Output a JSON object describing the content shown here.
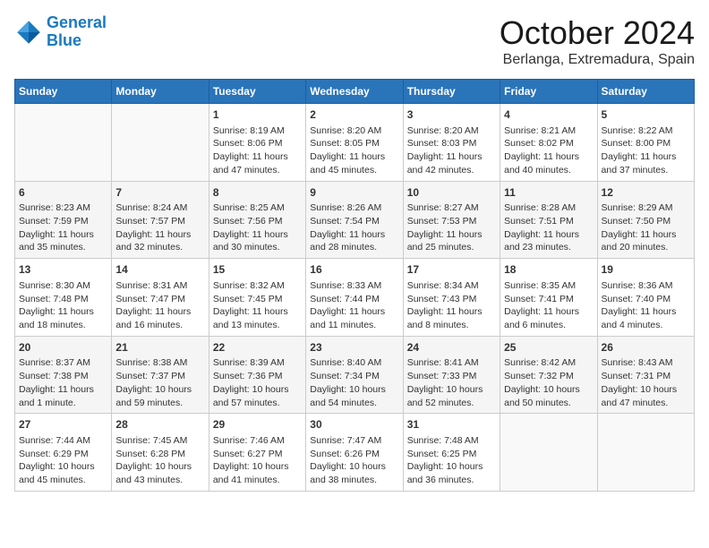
{
  "header": {
    "logo_line1": "General",
    "logo_line2": "Blue",
    "month": "October 2024",
    "location": "Berlanga, Extremadura, Spain"
  },
  "days_of_week": [
    "Sunday",
    "Monday",
    "Tuesday",
    "Wednesday",
    "Thursday",
    "Friday",
    "Saturday"
  ],
  "weeks": [
    [
      {
        "day": "",
        "info": ""
      },
      {
        "day": "",
        "info": ""
      },
      {
        "day": "1",
        "info": "Sunrise: 8:19 AM\nSunset: 8:06 PM\nDaylight: 11 hours and 47 minutes."
      },
      {
        "day": "2",
        "info": "Sunrise: 8:20 AM\nSunset: 8:05 PM\nDaylight: 11 hours and 45 minutes."
      },
      {
        "day": "3",
        "info": "Sunrise: 8:20 AM\nSunset: 8:03 PM\nDaylight: 11 hours and 42 minutes."
      },
      {
        "day": "4",
        "info": "Sunrise: 8:21 AM\nSunset: 8:02 PM\nDaylight: 11 hours and 40 minutes."
      },
      {
        "day": "5",
        "info": "Sunrise: 8:22 AM\nSunset: 8:00 PM\nDaylight: 11 hours and 37 minutes."
      }
    ],
    [
      {
        "day": "6",
        "info": "Sunrise: 8:23 AM\nSunset: 7:59 PM\nDaylight: 11 hours and 35 minutes."
      },
      {
        "day": "7",
        "info": "Sunrise: 8:24 AM\nSunset: 7:57 PM\nDaylight: 11 hours and 32 minutes."
      },
      {
        "day": "8",
        "info": "Sunrise: 8:25 AM\nSunset: 7:56 PM\nDaylight: 11 hours and 30 minutes."
      },
      {
        "day": "9",
        "info": "Sunrise: 8:26 AM\nSunset: 7:54 PM\nDaylight: 11 hours and 28 minutes."
      },
      {
        "day": "10",
        "info": "Sunrise: 8:27 AM\nSunset: 7:53 PM\nDaylight: 11 hours and 25 minutes."
      },
      {
        "day": "11",
        "info": "Sunrise: 8:28 AM\nSunset: 7:51 PM\nDaylight: 11 hours and 23 minutes."
      },
      {
        "day": "12",
        "info": "Sunrise: 8:29 AM\nSunset: 7:50 PM\nDaylight: 11 hours and 20 minutes."
      }
    ],
    [
      {
        "day": "13",
        "info": "Sunrise: 8:30 AM\nSunset: 7:48 PM\nDaylight: 11 hours and 18 minutes."
      },
      {
        "day": "14",
        "info": "Sunrise: 8:31 AM\nSunset: 7:47 PM\nDaylight: 11 hours and 16 minutes."
      },
      {
        "day": "15",
        "info": "Sunrise: 8:32 AM\nSunset: 7:45 PM\nDaylight: 11 hours and 13 minutes."
      },
      {
        "day": "16",
        "info": "Sunrise: 8:33 AM\nSunset: 7:44 PM\nDaylight: 11 hours and 11 minutes."
      },
      {
        "day": "17",
        "info": "Sunrise: 8:34 AM\nSunset: 7:43 PM\nDaylight: 11 hours and 8 minutes."
      },
      {
        "day": "18",
        "info": "Sunrise: 8:35 AM\nSunset: 7:41 PM\nDaylight: 11 hours and 6 minutes."
      },
      {
        "day": "19",
        "info": "Sunrise: 8:36 AM\nSunset: 7:40 PM\nDaylight: 11 hours and 4 minutes."
      }
    ],
    [
      {
        "day": "20",
        "info": "Sunrise: 8:37 AM\nSunset: 7:38 PM\nDaylight: 11 hours and 1 minute."
      },
      {
        "day": "21",
        "info": "Sunrise: 8:38 AM\nSunset: 7:37 PM\nDaylight: 10 hours and 59 minutes."
      },
      {
        "day": "22",
        "info": "Sunrise: 8:39 AM\nSunset: 7:36 PM\nDaylight: 10 hours and 57 minutes."
      },
      {
        "day": "23",
        "info": "Sunrise: 8:40 AM\nSunset: 7:34 PM\nDaylight: 10 hours and 54 minutes."
      },
      {
        "day": "24",
        "info": "Sunrise: 8:41 AM\nSunset: 7:33 PM\nDaylight: 10 hours and 52 minutes."
      },
      {
        "day": "25",
        "info": "Sunrise: 8:42 AM\nSunset: 7:32 PM\nDaylight: 10 hours and 50 minutes."
      },
      {
        "day": "26",
        "info": "Sunrise: 8:43 AM\nSunset: 7:31 PM\nDaylight: 10 hours and 47 minutes."
      }
    ],
    [
      {
        "day": "27",
        "info": "Sunrise: 7:44 AM\nSunset: 6:29 PM\nDaylight: 10 hours and 45 minutes."
      },
      {
        "day": "28",
        "info": "Sunrise: 7:45 AM\nSunset: 6:28 PM\nDaylight: 10 hours and 43 minutes."
      },
      {
        "day": "29",
        "info": "Sunrise: 7:46 AM\nSunset: 6:27 PM\nDaylight: 10 hours and 41 minutes."
      },
      {
        "day": "30",
        "info": "Sunrise: 7:47 AM\nSunset: 6:26 PM\nDaylight: 10 hours and 38 minutes."
      },
      {
        "day": "31",
        "info": "Sunrise: 7:48 AM\nSunset: 6:25 PM\nDaylight: 10 hours and 36 minutes."
      },
      {
        "day": "",
        "info": ""
      },
      {
        "day": "",
        "info": ""
      }
    ]
  ]
}
